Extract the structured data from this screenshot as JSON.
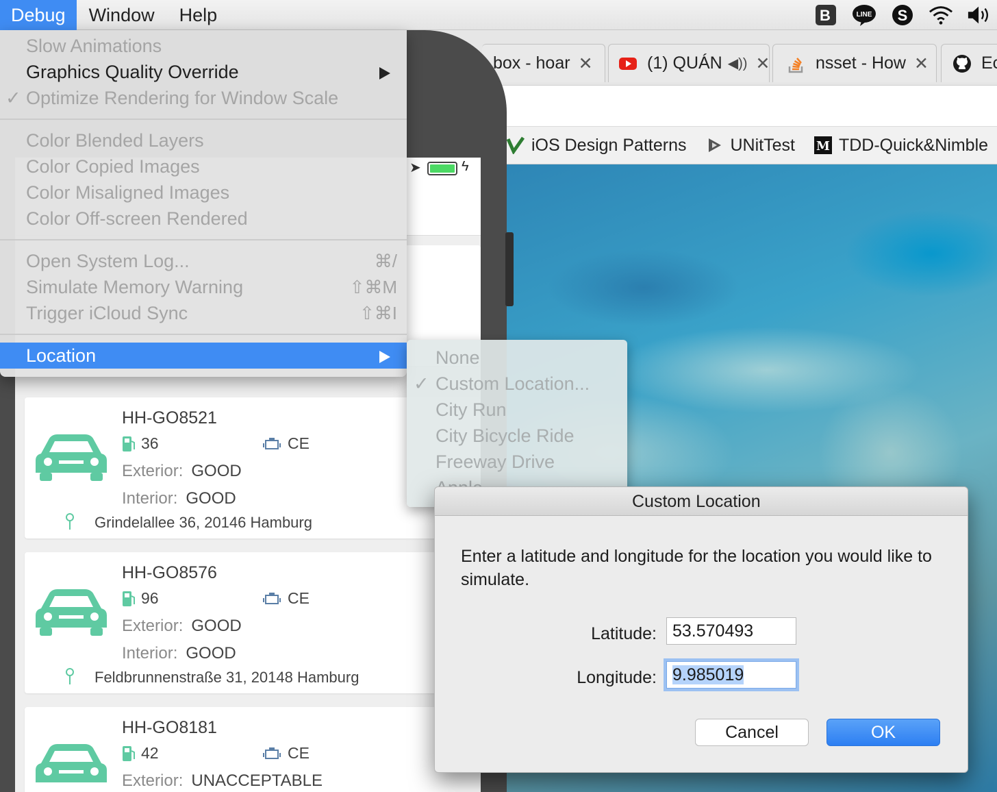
{
  "menubar": {
    "items": [
      "Debug",
      "Window",
      "Help"
    ],
    "tray_icons": [
      "bartender-icon",
      "line-icon",
      "skype-icon",
      "wifi-icon",
      "volume-icon"
    ]
  },
  "browser": {
    "tabs": [
      {
        "title": "box - hoar",
        "icon": "dropbox-icon"
      },
      {
        "title": "(1) QUÁN",
        "icon": "youtube-icon"
      },
      {
        "title": "nsset - How",
        "icon": "stackoverflow-icon"
      },
      {
        "title": "Ec",
        "icon": "github-icon"
      }
    ],
    "bookmarks": [
      {
        "label": "iOS Design Patterns",
        "icon": "bookmark-icon"
      },
      {
        "label": "UNitTest",
        "icon": "bookmark-icon"
      },
      {
        "label": "TDD-Quick&Nimble",
        "icon": "medium-icon"
      }
    ]
  },
  "debug_menu": {
    "group1": [
      {
        "label": "Slow Animations",
        "enabled": false
      },
      {
        "label": "Graphics Quality Override",
        "enabled": true,
        "submenu": true
      },
      {
        "label": "Optimize Rendering for Window Scale",
        "enabled": false,
        "checked": true
      }
    ],
    "group2": [
      {
        "label": "Color Blended Layers"
      },
      {
        "label": "Color Copied Images"
      },
      {
        "label": "Color Misaligned Images"
      },
      {
        "label": "Color Off-screen Rendered"
      }
    ],
    "group3": [
      {
        "label": "Open System Log...",
        "shortcut": "⌘/"
      },
      {
        "label": "Simulate Memory Warning",
        "shortcut": "⇧⌘M"
      },
      {
        "label": "Trigger iCloud Sync",
        "shortcut": "⇧⌘I"
      }
    ],
    "location": {
      "label": "Location",
      "highlighted": true
    }
  },
  "location_submenu": {
    "items": [
      {
        "label": "None"
      },
      {
        "label": "Custom Location...",
        "checked": true
      },
      {
        "label": "City Run"
      },
      {
        "label": "City Bicycle Ride"
      },
      {
        "label": "Freeway Drive"
      },
      {
        "label": "Apple"
      }
    ]
  },
  "app": {
    "cards": [
      {
        "plate": "HH-GO8521",
        "fuel": "36",
        "engine": "CE",
        "exterior_label": "Exterior:",
        "exterior": "GOOD",
        "interior_label": "Interior:",
        "interior": "GOOD",
        "address": "Grindelallee 36, 20146 Hamburg"
      },
      {
        "plate": "HH-GO8576",
        "fuel": "96",
        "engine": "CE",
        "exterior_label": "Exterior:",
        "exterior": "GOOD",
        "interior_label": "Interior:",
        "interior": "GOOD",
        "address": "Feldbrunnenstraße 31, 20148 Hamburg"
      },
      {
        "plate": "HH-GO8181",
        "fuel": "42",
        "engine": "CE",
        "exterior_label": "Exterior:",
        "exterior": "UNACCEPTABLE",
        "interior_label": "",
        "interior": "",
        "address": ""
      }
    ],
    "car_color": "#5fcaa2"
  },
  "dialog": {
    "title": "Custom Location",
    "message": "Enter a latitude and longitude for the location you would like to simulate.",
    "latitude_label": "Latitude:",
    "latitude": "53.570493",
    "longitude_label": "Longitude:",
    "longitude": "9.985019",
    "cancel": "Cancel",
    "ok": "OK"
  },
  "colors": {
    "accent": "#3f8cf3"
  }
}
